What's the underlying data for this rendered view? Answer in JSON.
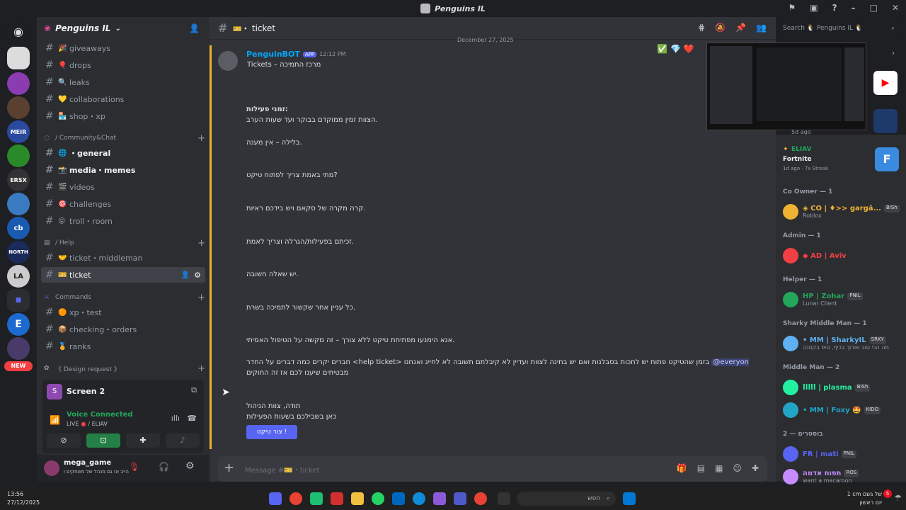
{
  "window": {
    "title": "Penguins IL"
  },
  "rail": {
    "new_badge": "NEW"
  },
  "guild": {
    "name": "Penguins IL"
  },
  "channels": {
    "top": [
      {
        "label": "giveaways",
        "emoji": "🎉"
      },
      {
        "label": "drops",
        "emoji": "🎈"
      },
      {
        "label": "leaks",
        "emoji": "🔍"
      },
      {
        "label": "collaborations",
        "emoji": "💛"
      },
      {
        "label": "shop・xp",
        "emoji": "🏪"
      }
    ],
    "community_cat": "/ Community&Chat",
    "community": [
      {
        "label": "・general",
        "emoji": "🌐"
      },
      {
        "label": "media・memes",
        "emoji": "📸"
      },
      {
        "label": "videos",
        "emoji": "🎬"
      },
      {
        "label": "challenges",
        "emoji": "🎯"
      },
      {
        "label": "troll・room",
        "emoji": "😝"
      }
    ],
    "help_cat": "/ Help",
    "help": [
      {
        "label": "ticket・middleman",
        "emoji": "🤝"
      },
      {
        "label": "ticket",
        "emoji": "🎫"
      }
    ],
    "commands_cat": "Commands",
    "commands": [
      {
        "label": "xp・test",
        "emoji": "🟠"
      },
      {
        "label": "checking・orders",
        "emoji": "📦"
      },
      {
        "label": "ranks",
        "emoji": "🏅"
      }
    ],
    "design_cat": "《 Design request 》"
  },
  "voice": {
    "screen_title": "Screen 2",
    "status": "Voice Connected",
    "live_label": "LIVE",
    "channel": "/ ELIAV"
  },
  "user": {
    "name": "mega_game",
    "status": "הייב אז גם מנהל של משחקים טוב..."
  },
  "chat": {
    "channel_name": "ticket",
    "date_divider": "December 27, 2025",
    "author": "PenguinBOT",
    "app_tag": "APP",
    "time": "12:12 PM",
    "first_line": "Tickets – מרכז התמיכה",
    "lines": [
      "זמני פעילות:",
      "הצוות זמין ממוקדם בבוקר ועד שעות הערב.",
      "בלילה – אין מענה.",
      "מתי באמת צריך לפתוח טיקט?",
      "קרה מקרה של סקאם ויש בידכם ראיות.",
      "זכיתם בפעילות/הגרלה וצריך לאמת.",
      "יש שאלה חשובה.",
      "כל עניין אחר שקשור לתמיכה בשרת.",
      "אנא הימנעו מפתיחת טיקט ללא צורך – זה מקשה על הטיפול האמיתי.",
      "חברים יקרים כמה דברים על החדר <help ticket> בזמן שהטיקט פתוח יש לחכות בסבלנות ואם יש בחינה לצוות ועדיין לא קיבלתם תשובה לא לחייג ואנחנו",
      "מבטיחים שיענו לכם אז זה החוקים",
      "תודה, צוות הניהול",
      "כאן בשבילכם בשעות הפעילות"
    ],
    "mention": "@everyone",
    "button_label": "צור טיקט !",
    "input_placeholder": "Message #🎫・ticket"
  },
  "search": {
    "placeholder": "Search 🐧 Penguins IL 🐧"
  },
  "activity": {
    "time_ago": "5d ago"
  },
  "eliav": {
    "name": "ELIAV",
    "game": "Fortnite",
    "meta": "1d ago · 7x Streak"
  },
  "members": {
    "groups": [
      {
        "title": "Co Owner — 1",
        "items": [
          {
            "name": "◈ CO | ♦>> gargâ...",
            "sub": "Roblox",
            "tag": "BISh",
            "color": "#f0b232"
          }
        ]
      },
      {
        "title": "Admin — 1",
        "items": [
          {
            "name": "◆ AD | Aviv",
            "sub": "",
            "tag": "",
            "color": "#f23f43"
          }
        ]
      },
      {
        "title": "Helper — 1",
        "items": [
          {
            "name": "HP | Zohar",
            "sub": "Lunar Client",
            "tag": "PNIL",
            "color": "#23a55a"
          }
        ]
      },
      {
        "title": "Sharky Middle Man — 1",
        "items": [
          {
            "name": "• MM | SharkyIL",
            "sub": "מה הכי טוב אורוך בכיף, טיפ בקטנה",
            "tag": "SRKY",
            "color": "#5fb0f0"
          }
        ]
      },
      {
        "title": "Middle Man — 2",
        "items": [
          {
            "name": "ꟾꟾꟾꟾꟾ | plasma",
            "sub": "",
            "tag": "BISh",
            "color": "#23f0a0"
          },
          {
            "name": "• MM | Foxy 🤩",
            "sub": "",
            "tag": "KIDO",
            "color": "#23a5c8"
          }
        ]
      },
      {
        "title": "בוסטרים — 2",
        "items": [
          {
            "name": "FR | mati",
            "sub": "",
            "tag": "PNIL",
            "color": "#5865f2"
          },
          {
            "name": "תפוח אדמה",
            "sub": "want a macaroon",
            "tag": "ROS",
            "color": "#c78cff"
          }
        ]
      }
    ]
  },
  "taskbar": {
    "clock": "13:56",
    "date": "27/12/2025",
    "search_placeholder": "חפש",
    "weather": "1 cm של גשם",
    "weather_sub": "יום ראשון",
    "notif_count": "5"
  }
}
